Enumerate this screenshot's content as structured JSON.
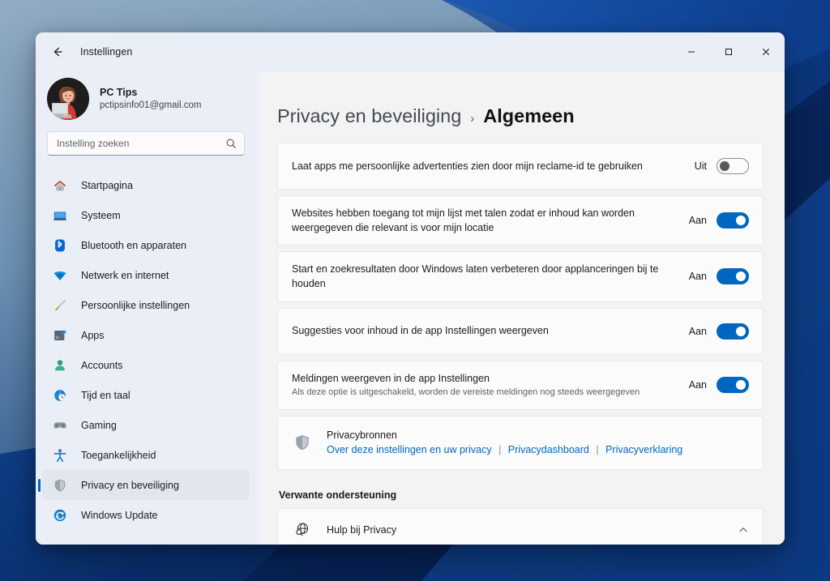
{
  "window": {
    "app_title": "Instellingen",
    "back_icon": "back-arrow-icon",
    "minimize_label": "–",
    "maximize_label": "□",
    "close_label": "✕"
  },
  "account": {
    "name": "PC Tips",
    "email": "pctipsinfo01@gmail.com",
    "avatar_icon": "user-avatar-illustration"
  },
  "search": {
    "placeholder": "Instelling zoeken",
    "value": "",
    "icon": "search-icon"
  },
  "sidebar": {
    "items": [
      {
        "label": "Startpagina",
        "icon": "home-icon",
        "active": false
      },
      {
        "label": "Systeem",
        "icon": "system-monitor-icon",
        "active": false
      },
      {
        "label": "Bluetooth en apparaten",
        "icon": "bluetooth-icon",
        "active": false
      },
      {
        "label": "Netwerk en internet",
        "icon": "wifi-icon",
        "active": false
      },
      {
        "label": "Persoonlijke instellingen",
        "icon": "paintbrush-icon",
        "active": false
      },
      {
        "label": "Apps",
        "icon": "apps-icon",
        "active": false
      },
      {
        "label": "Accounts",
        "icon": "account-person-icon",
        "active": false
      },
      {
        "label": "Tijd en taal",
        "icon": "clock-globe-icon",
        "active": false
      },
      {
        "label": "Gaming",
        "icon": "gamepad-icon",
        "active": false
      },
      {
        "label": "Toegankelijkheid",
        "icon": "accessibility-icon",
        "active": false
      },
      {
        "label": "Privacy en beveiliging",
        "icon": "shield-icon",
        "active": true
      },
      {
        "label": "Windows Update",
        "icon": "update-refresh-icon",
        "active": false
      }
    ]
  },
  "breadcrumb": {
    "parent": "Privacy en beveiliging",
    "separator": "›",
    "current": "Algemeen"
  },
  "settings": [
    {
      "title": "Laat apps me persoonlijke advertenties zien door mijn reclame-id te gebruiken",
      "subtitle": "",
      "state_label": "Uit",
      "state": "off"
    },
    {
      "title": "Websites hebben toegang tot mijn lijst met talen zodat er inhoud kan worden weergegeven die relevant is voor mijn locatie",
      "subtitle": "",
      "state_label": "Aan",
      "state": "on"
    },
    {
      "title": "Start en zoekresultaten door Windows laten verbeteren door applanceringen bij te houden",
      "subtitle": "",
      "state_label": "Aan",
      "state": "on"
    },
    {
      "title": "Suggesties voor inhoud in de app Instellingen weergeven",
      "subtitle": "",
      "state_label": "Aan",
      "state": "on"
    },
    {
      "title": "Meldingen weergeven in de app Instellingen",
      "subtitle": "Als deze optie is uitgeschakeld, worden de vereiste meldingen nog steeds weergegeven",
      "state_label": "Aan",
      "state": "on"
    }
  ],
  "privacy_resources": {
    "icon": "shield-icon",
    "title": "Privacybronnen",
    "links": [
      "Over deze instellingen en uw privacy",
      "Privacydashboard",
      "Privacyverklaring"
    ],
    "divider": "|"
  },
  "related_support": {
    "heading": "Verwante ondersteuning",
    "item_label": "Hulp bij Privacy",
    "item_icon": "globe-search-icon",
    "chevron_icon": "chevron-up-icon"
  },
  "colors": {
    "accent": "#0067c0",
    "link": "#0067c0",
    "sidebar_bg": "#eaeff7",
    "content_bg": "#f3f3f3",
    "card_bg": "#fbfbfb",
    "selected_bg": "#e2e7ef"
  }
}
